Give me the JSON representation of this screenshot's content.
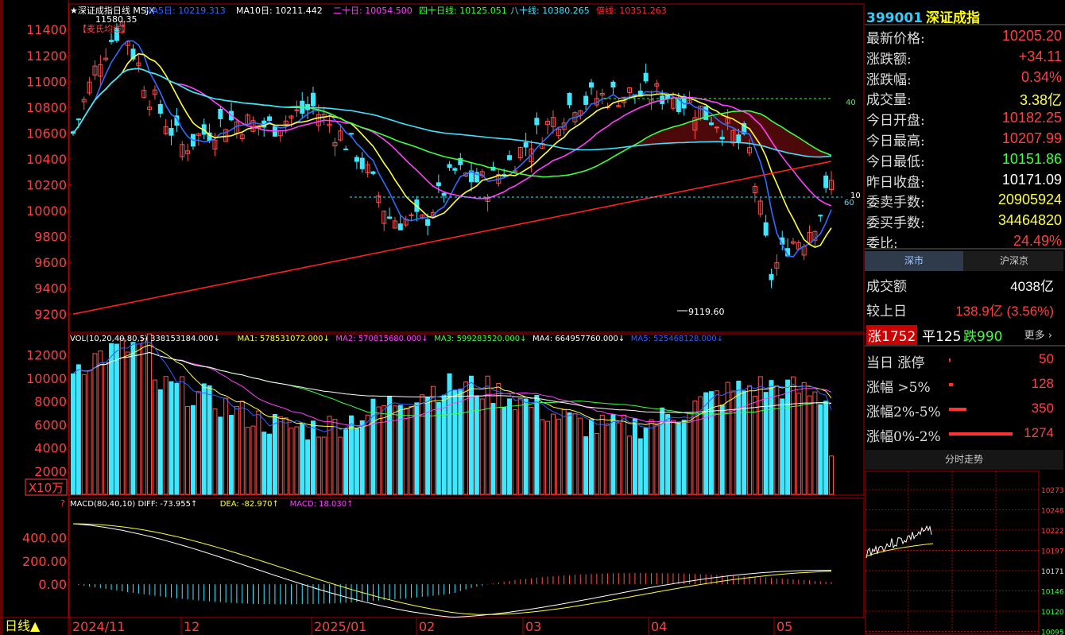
{
  "chart_top": {
    "legend": [
      {
        "label": "★深证成指日线 MSJX",
        "color": "#ffffff"
      },
      {
        "label": "MA5日: 10219.313",
        "color": "#2f6cff"
      },
      {
        "label": "MA10日: 10211.442",
        "color": "#ffffff"
      },
      {
        "label": "二十日: 10054.500",
        "color": "#ff40ff"
      },
      {
        "label": "四十日线: 10125.051",
        "color": "#40ff40"
      },
      {
        "label": "八十线: 10380.265",
        "color": "#40e0ff"
      },
      {
        "label": "倍线: 10351.263",
        "color": "#ff3030"
      }
    ],
    "high_label": "11580.35",
    "low_label": "9119.60",
    "formula_tag": "【麦氏均线】",
    "mark_40": "40",
    "mark_10": "10",
    "mark_60": "60"
  },
  "vol_legend": [
    {
      "label": "VOL(10,20,40,80,5) 338153184.000↓",
      "color": "#ffffff"
    },
    {
      "label": "MA1: 578531072.000↓",
      "color": "#ffff40"
    },
    {
      "label": "MA2: 570815680.000↓",
      "color": "#ff40ff"
    },
    {
      "label": "MA3: 599283520.000↓",
      "color": "#40ff40"
    },
    {
      "label": "MA4: 664957760.000↓",
      "color": "#ffffff"
    },
    {
      "label": "MA5: 525468128.000↓",
      "color": "#3060ff"
    }
  ],
  "vol_unit": "X10万",
  "macd_legend": [
    {
      "label": "MACD(80,40,10) DIFF: -73.955↑",
      "color": "#ffffff"
    },
    {
      "label": "DEA: -82.970↑",
      "color": "#ffff40"
    },
    {
      "label": "MACD: 18.030↑",
      "color": "#ff40ff"
    }
  ],
  "macd_mark": "?",
  "period_button": "日线▲",
  "x_labels": [
    "2024/11",
    "12",
    "2025/01",
    "02",
    "03",
    "04",
    "05"
  ],
  "quote": {
    "code": "399001",
    "name": "深证成指",
    "rows": [
      {
        "k": "最新价格:",
        "v": "10205.20",
        "c": "#ff4040"
      },
      {
        "k": "涨跌额:",
        "v": "+34.11",
        "c": "#ff4040"
      },
      {
        "k": "涨跌幅:",
        "v": "0.34%",
        "c": "#ff4040"
      },
      {
        "k": "成交量:",
        "v": "3.38亿",
        "c": "#ffff40"
      },
      {
        "k": "今日开盘:",
        "v": "10182.25",
        "c": "#ff4040"
      },
      {
        "k": "今日最高:",
        "v": "10207.99",
        "c": "#ff4040"
      },
      {
        "k": "今日最低:",
        "v": "10151.86",
        "c": "#40ff40"
      },
      {
        "k": "昨日收盘:",
        "v": "10171.09",
        "c": "#ffffff"
      },
      {
        "k": "委卖手数:",
        "v": "20905924",
        "c": "#ffff40"
      },
      {
        "k": "委买手数:",
        "v": "34464820",
        "c": "#ffff40"
      },
      {
        "k": "委比:",
        "v": "24.49%",
        "c": "#ff4040"
      }
    ]
  },
  "tabs": [
    "深市",
    "沪深京"
  ],
  "stats": {
    "turnover_k": "成交额",
    "turnover_v": "4038亿",
    "prev_k": "较上日",
    "prev_v": "138.9亿 (3.56%)",
    "adv_up": "涨1752",
    "adv_flat": "平125",
    "adv_down": "跌990",
    "more": "更多 ›",
    "rows": [
      {
        "k": "当日 涨停",
        "v": "50",
        "bar": 0.01
      },
      {
        "k": "涨幅 >5%",
        "v": "128",
        "bar": 0.06
      },
      {
        "k": "涨幅2%-5%",
        "v": "350",
        "bar": 0.28
      },
      {
        "k": "涨幅0%-2%",
        "v": "1274",
        "bar": 1.0
      }
    ]
  },
  "mini_title": "分时走势",
  "mini_ticks": [
    "10273",
    "10248",
    "10222",
    "10197",
    "10171",
    "10146",
    "10120",
    "10095"
  ]
}
